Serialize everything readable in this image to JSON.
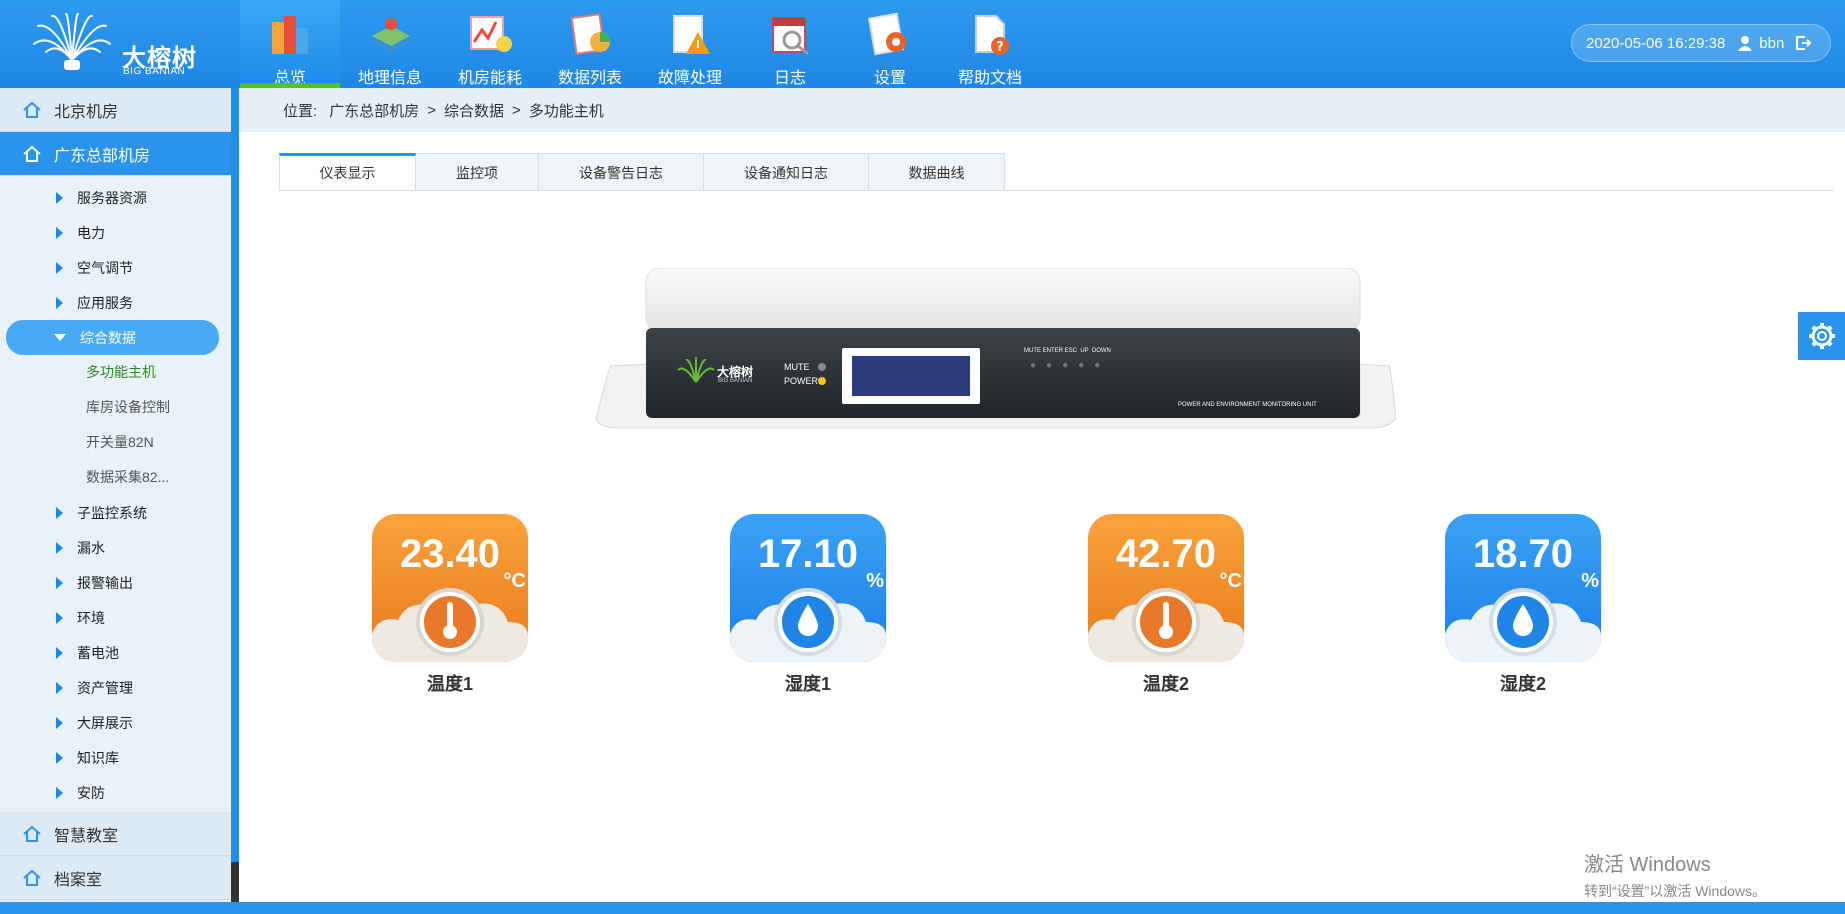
{
  "header": {
    "brand": "大榕树",
    "brand_sub": "BIG BANIAN",
    "nav": [
      {
        "label": "总览",
        "icon": "overview-icon",
        "active": true
      },
      {
        "label": "地理信息",
        "icon": "map-icon"
      },
      {
        "label": "机房能耗",
        "icon": "energy-chart-icon"
      },
      {
        "label": "数据列表",
        "icon": "data-list-icon"
      },
      {
        "label": "故障处理",
        "icon": "fault-warning-icon"
      },
      {
        "label": "日志",
        "icon": "calendar-log-icon"
      },
      {
        "label": "设置",
        "icon": "settings-icon"
      },
      {
        "label": "帮助文档",
        "icon": "help-doc-icon"
      }
    ],
    "datetime": "2020-05-06  16:29:38",
    "username": "bbn"
  },
  "sidebar": {
    "groups": [
      {
        "label": "北京机房"
      },
      {
        "label": "广东总部机房",
        "active": true
      }
    ],
    "sub_items": [
      {
        "label": "服务器资源"
      },
      {
        "label": "电力"
      },
      {
        "label": "空气调节"
      },
      {
        "label": "应用服务"
      },
      {
        "label": "综合数据",
        "open": true
      }
    ],
    "leaves": [
      {
        "label": "多功能主机",
        "active": true
      },
      {
        "label": "库房设备控制"
      },
      {
        "label": "开关量82N"
      },
      {
        "label": "数据采集82..."
      }
    ],
    "sub_items_after": [
      {
        "label": "子监控系统"
      },
      {
        "label": "漏水"
      },
      {
        "label": "报警输出"
      },
      {
        "label": "环境"
      },
      {
        "label": "蓄电池"
      },
      {
        "label": "资产管理"
      },
      {
        "label": "大屏展示"
      },
      {
        "label": "知识库"
      },
      {
        "label": "安防"
      }
    ],
    "groups_after": [
      {
        "label": "智慧教室"
      },
      {
        "label": "档案室"
      }
    ]
  },
  "breadcrumb": {
    "prefix": "位置:",
    "items": [
      "广东总部机房",
      "综合数据",
      "多功能主机"
    ],
    "separator": ">"
  },
  "tabs": [
    {
      "label": "仪表显示",
      "active": true
    },
    {
      "label": "监控项"
    },
    {
      "label": "设备警告日志"
    },
    {
      "label": "设备通知日志"
    },
    {
      "label": "数据曲线"
    }
  ],
  "device": {
    "brand": "大榕树",
    "brand_sub": "BIG BANIAN",
    "mute": "MUTE",
    "power": "POWER",
    "buttons": "MUTE ENTER ESC  UP  DOWN",
    "model": "POWER AND ENVIRONMENT MONITORING UNIT"
  },
  "gauges": [
    {
      "value": "23.40",
      "unit": "°C",
      "label": "温度1",
      "kind": "temperature",
      "color": "#f08a24"
    },
    {
      "value": "17.10",
      "unit": "%",
      "label": "湿度1",
      "kind": "humidity",
      "color": "#1f8ef1"
    },
    {
      "value": "42.70",
      "unit": "°C",
      "label": "温度2",
      "kind": "temperature",
      "color": "#f08a24"
    },
    {
      "value": "18.70",
      "unit": "%",
      "label": "湿度2",
      "kind": "humidity",
      "color": "#1f8ef1"
    }
  ],
  "watermark": {
    "line1": "激活 Windows",
    "line2": "转到“设置”以激活 Windows。"
  }
}
